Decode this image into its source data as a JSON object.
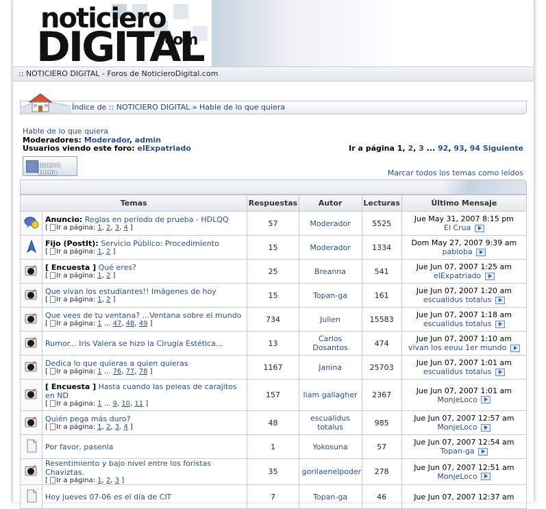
{
  "site": {
    "title_bar": ":: NOTICIERO DIGITAL - Foros de NoticieroDigital.com",
    "logo_top": "noticiero",
    "logo_main": "DIGITAL",
    "logo_suffix": ".com"
  },
  "breadcrumb": {
    "index": "Índice de :: NOTICIERO DIGITAL",
    "sep": "»",
    "current": "Hable de lo que quiera"
  },
  "forum": {
    "title": "Hable de lo que quiera",
    "moderators_label": "Moderadores:",
    "moderators": [
      "Moderador",
      "admin"
    ],
    "viewing_label": "Usuarios viendo este foro:",
    "viewing_user": "elExpatriado"
  },
  "pager": {
    "label": "Ir a página",
    "current": "1",
    "pages": [
      "2",
      "3"
    ],
    "ellipsis": "...",
    "pages_end": [
      "92",
      "93",
      "94"
    ],
    "next": "Siguiente"
  },
  "new_topic": "nuevo tema",
  "mark_all": "Marcar todos los temas como leídos",
  "columns": {
    "topics": "Temas",
    "replies": "Respuestas",
    "author": "Autor",
    "views": "Lecturas",
    "last": "Último Mensaje"
  },
  "goto_page": "Ir a página:",
  "topics": [
    {
      "icon": "announcement-icon",
      "type": "Anuncio:",
      "title": "Reglas en período de prueba - HDLQQ",
      "pages": "1, 2, 3, 4",
      "replies": "57",
      "author": "Moderador",
      "views": "5525",
      "last_date": "Jue May 31, 2007 8:15 pm",
      "last_user": "El Crua"
    },
    {
      "icon": "sticky-icon",
      "type": "Fijo (PostIt):",
      "title": "Servicio Público: Procedimiento",
      "pages": "1, 2",
      "replies": "15",
      "author": "Moderador",
      "views": "1334",
      "last_date": "Dom May 27, 2007 9:39 am",
      "last_user": "pabloba"
    },
    {
      "icon": "hot-folder-icon",
      "type": "[ Encuesta ]",
      "title": "Qué eres?",
      "pages": "1, 2",
      "replies": "25",
      "author": "Breanna",
      "views": "541",
      "last_date": "Jue Jun 07, 2007 1:25 am",
      "last_user": "elExpatriado"
    },
    {
      "icon": "hot-folder-icon",
      "type": "",
      "title": "Que vivan los estudiantes!! Imágenes de hoy",
      "pages": "1, 2",
      "replies": "15",
      "author": "Topan-ga",
      "views": "161",
      "last_date": "Jue Jun 07, 2007 1:20 am",
      "last_user": "escualidus totalus"
    },
    {
      "icon": "hot-folder-icon",
      "type": "",
      "title": "Que vees de tu ventana? ...Ventana sobre el mundo",
      "pages": "1 ... 47, 48, 49",
      "replies": "734",
      "author": "Julien",
      "views": "15583",
      "last_date": "Jue Jun 07, 2007 1:18 am",
      "last_user": "escualidus totalus"
    },
    {
      "icon": "hot-folder-icon",
      "type": "",
      "title": "Rumor... Iris Valera se hizo la Cirugía Estética...",
      "pages": "",
      "replies": "13",
      "author": "Carlos Dosantos",
      "views": "474",
      "last_date": "Jue Jun 07, 2007 1:10 am",
      "last_user": "vivan los eeuu 1er mundo"
    },
    {
      "icon": "hot-folder-icon",
      "type": "",
      "title": "Dedica lo que quieras a quien quieras",
      "pages": "1 ... 76, 77, 78",
      "replies": "1167",
      "author": "Janina",
      "views": "25703",
      "last_date": "Jue Jun 07, 2007 1:01 am",
      "last_user": "escualidus totalus"
    },
    {
      "icon": "hot-folder-icon",
      "type": "[ Encuesta ]",
      "title": "Hasta cuando las peleas de carajitos en ND",
      "pages": "1 ... 9, 10, 11",
      "replies": "157",
      "author": "liam gallagher",
      "views": "2367",
      "last_date": "Jue Jun 07, 2007 1:01 am",
      "last_user": "MonjeLoco"
    },
    {
      "icon": "hot-folder-icon",
      "type": "",
      "title": "Quién pega más duro?",
      "pages": "1, 2, 3, 4",
      "replies": "48",
      "author": "escualidus totalus",
      "views": "985",
      "last_date": "Jue Jun 07, 2007 12:57 am",
      "last_user": "MonjeLoco"
    },
    {
      "icon": "folder-icon",
      "type": "",
      "title": "Por favor, pasenla",
      "pages": "",
      "replies": "1",
      "author": "Yokosuna",
      "views": "57",
      "last_date": "Jue Jun 07, 2007 12:54 am",
      "last_user": "Topan-ga"
    },
    {
      "icon": "hot-folder-icon",
      "type": "",
      "title": "Resentimiento y bajo nivel entre los foristas Chaviztas.",
      "pages": "1, 2, 3",
      "replies": "35",
      "author": "gorilaenelpoder",
      "views": "278",
      "last_date": "Jue Jun 07, 2007 12:51 am",
      "last_user": "MonjeLoco"
    },
    {
      "icon": "folder-icon",
      "type": "",
      "title": "Hoy jueves 07-06 es el día de CIT",
      "pages": "",
      "replies": "7",
      "author": "Topan-ga",
      "views": "46",
      "last_date": "Jue Jun 07, 2007 12:37 am",
      "last_user": ""
    }
  ]
}
